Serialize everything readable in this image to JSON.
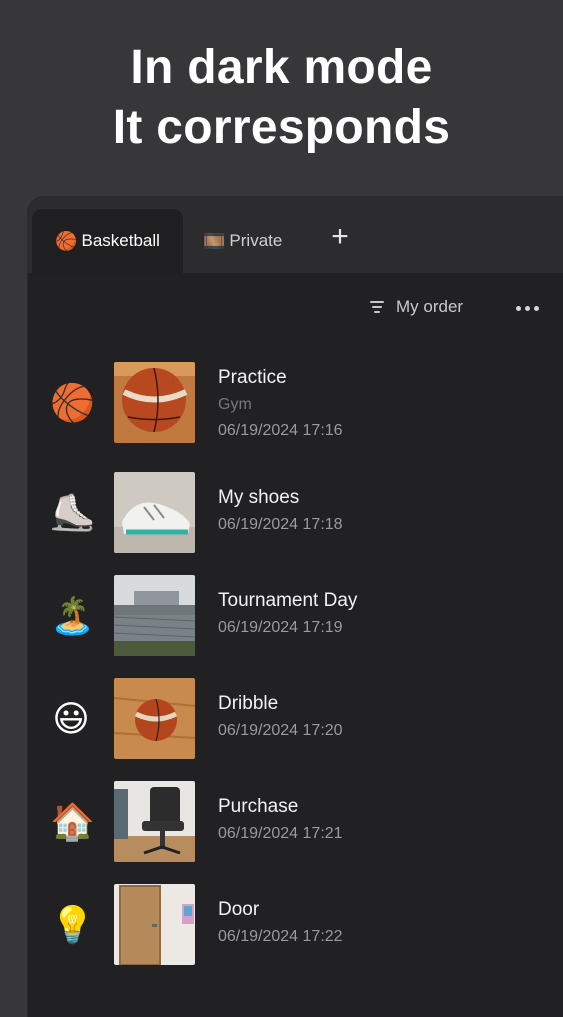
{
  "headline": {
    "line1": "In dark mode",
    "line2": "It corresponds"
  },
  "tabs": [
    {
      "emoji": "🏀",
      "label": "Basketball",
      "active": true
    },
    {
      "emoji": "🎞️",
      "label": "Private",
      "active": false
    }
  ],
  "toolbar": {
    "add_tab": "+",
    "sort_label": "My order"
  },
  "items": [
    {
      "emoji": "🏀",
      "title": "Practice",
      "subtitle": "Gym",
      "date": "06/19/2024 17:16"
    },
    {
      "emoji": "⛸️",
      "title": "My shoes",
      "subtitle": "",
      "date": "06/19/2024 17:18"
    },
    {
      "emoji": "🏝️",
      "title": "Tournament Day",
      "subtitle": "",
      "date": "06/19/2024 17:19"
    },
    {
      "emoji": "😃",
      "title": "Dribble",
      "subtitle": "",
      "date": "06/19/2024 17:20"
    },
    {
      "emoji": "🏠",
      "title": "Purchase",
      "subtitle": "",
      "date": "06/19/2024 17:21"
    },
    {
      "emoji": "💡",
      "title": "Door",
      "subtitle": "",
      "date": "06/19/2024 17:22"
    }
  ]
}
